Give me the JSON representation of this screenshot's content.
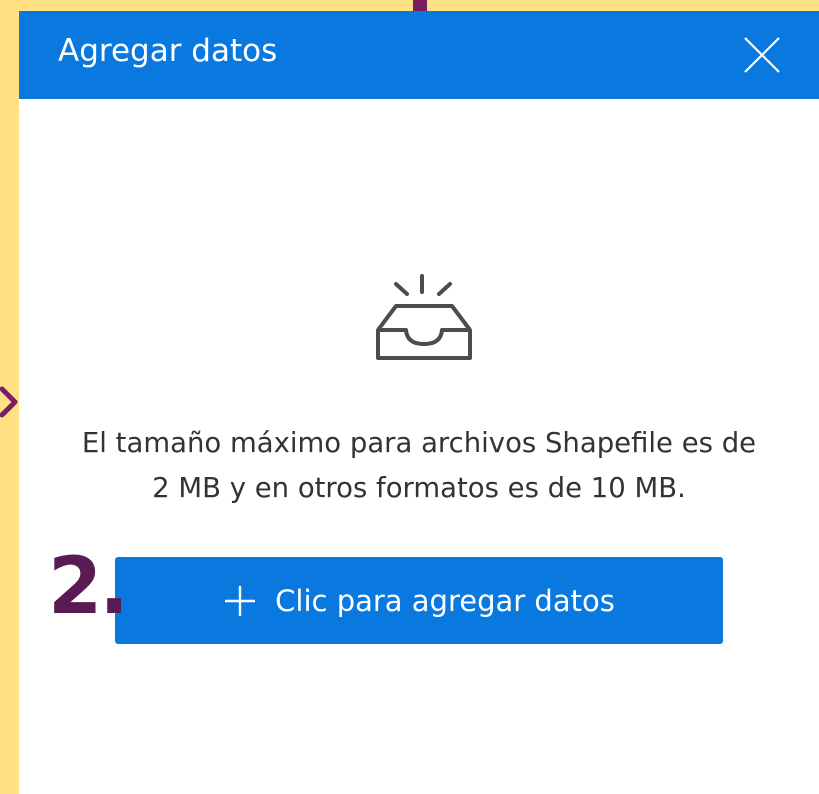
{
  "dialog": {
    "title": "Agregar datos",
    "close_icon": "close-icon"
  },
  "empty_state": {
    "icon": "inbox-icon",
    "line1": "El tamaño máximo para archivos Shapefile es de",
    "line2": "2 MB y en otros formatos es de 10 MB."
  },
  "add_button": {
    "label": "Clic para agregar datos",
    "icon": "plus-icon"
  },
  "annotation": {
    "step_number": "2."
  },
  "colors": {
    "background": "#FFE082",
    "header": "#0A79DF",
    "button": "#0A79DF",
    "text": "#333333",
    "step_number": "#5A1A52",
    "decoration": "#7B1D65"
  }
}
